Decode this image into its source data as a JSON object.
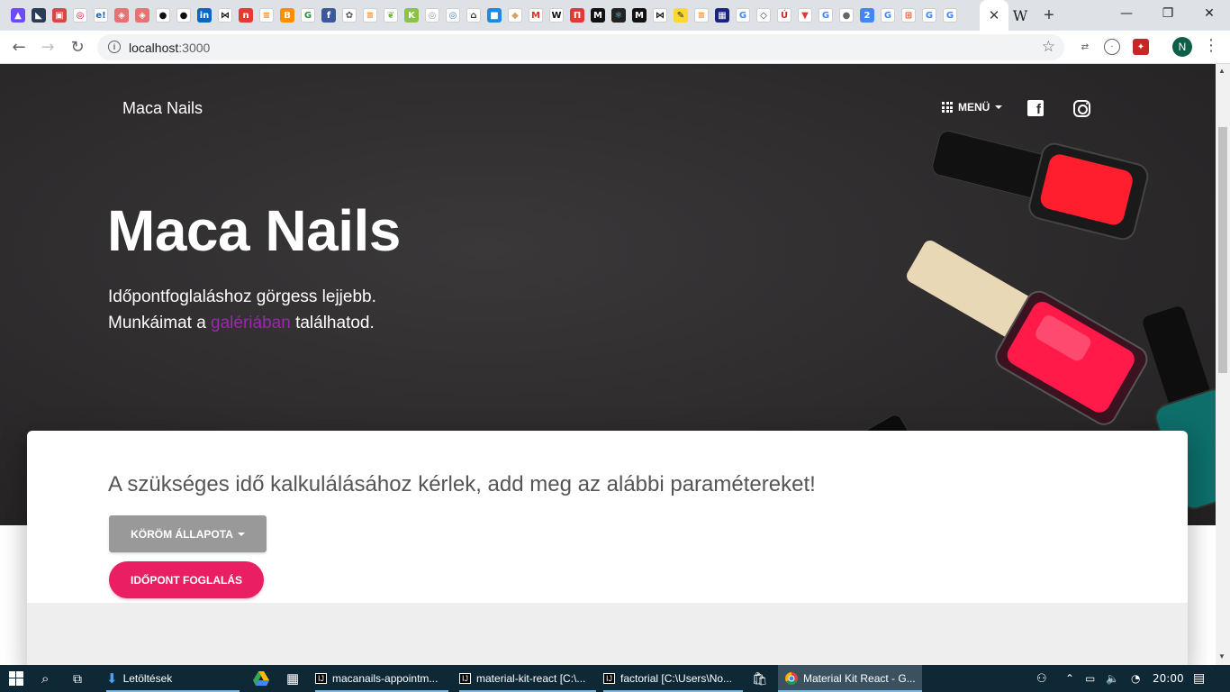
{
  "browser": {
    "tab_favicons": [
      {
        "name": "proton-icon",
        "glyph": "▲",
        "bg": "#6d4aff"
      },
      {
        "name": "zeplin-icon",
        "glyph": "◣",
        "bg": "#2b3a55"
      },
      {
        "name": "ext-red-icon",
        "glyph": "▣",
        "bg": "#d44"
      },
      {
        "name": "ring-icon",
        "glyph": "◎",
        "bg": "#fff",
        "fg": "#e03"
      },
      {
        "name": "eloquent-icon",
        "glyph": "e!",
        "bg": "#fff",
        "fg": "#1565c0"
      },
      {
        "name": "sketch-icon-1",
        "glyph": "◈",
        "bg": "#e57373"
      },
      {
        "name": "sketch-icon-2",
        "glyph": "◈",
        "bg": "#e57373"
      },
      {
        "name": "github-icon-1",
        "glyph": "●",
        "bg": "#fff",
        "fg": "#111"
      },
      {
        "name": "github-icon-2",
        "glyph": "●",
        "bg": "#fff",
        "fg": "#111"
      },
      {
        "name": "linkedin-icon",
        "glyph": "in",
        "bg": "#0a66c2"
      },
      {
        "name": "bowtie-icon",
        "glyph": "⋈",
        "bg": "#fff",
        "fg": "#111"
      },
      {
        "name": "n-icon",
        "glyph": "n",
        "bg": "#e53935"
      },
      {
        "name": "stackoverflow-icon-1",
        "glyph": "≡",
        "bg": "#fff",
        "fg": "#f48024"
      },
      {
        "name": "blogger-icon",
        "glyph": "B",
        "bg": "#ff8f00"
      },
      {
        "name": "geeks-icon",
        "glyph": "G",
        "bg": "#fff",
        "fg": "#2f8d46"
      },
      {
        "name": "facebook-icon",
        "glyph": "f",
        "bg": "#3b5998"
      },
      {
        "name": "meetup-icon",
        "glyph": "✿",
        "bg": "#fff",
        "fg": "#555"
      },
      {
        "name": "stackoverflow-icon-2",
        "glyph": "≡",
        "bg": "#fff",
        "fg": "#f48024"
      },
      {
        "name": "spring-icon",
        "glyph": "❦",
        "bg": "#fff",
        "fg": "#6db33f"
      },
      {
        "name": "kotlin-icon",
        "glyph": "K",
        "bg": "#8bc34a"
      },
      {
        "name": "circle-icon-1",
        "glyph": "◎",
        "bg": "#fff",
        "fg": "#999"
      },
      {
        "name": "circle-icon-2",
        "glyph": "◎",
        "bg": "#fff",
        "fg": "#3f7fbf"
      },
      {
        "name": "hat-icon",
        "glyph": "⌂",
        "bg": "#fff",
        "fg": "#333"
      },
      {
        "name": "box-icon",
        "glyph": "■",
        "bg": "#1e88e5"
      },
      {
        "name": "package-icon",
        "glyph": "◆",
        "bg": "#fff",
        "fg": "#d9a066"
      },
      {
        "name": "gmail-icon",
        "glyph": "M",
        "bg": "#fff",
        "fg": "#d93025"
      },
      {
        "name": "wikipedia-icon-1",
        "glyph": "W",
        "bg": "#fff",
        "fg": "#111"
      },
      {
        "name": "n-icon-2",
        "glyph": "П",
        "bg": "#e53935"
      },
      {
        "name": "medium-icon-1",
        "glyph": "M",
        "bg": "#111"
      },
      {
        "name": "react-icon",
        "glyph": "⚛",
        "bg": "#222",
        "fg": "#61dafb"
      },
      {
        "name": "medium-icon-2",
        "glyph": "M",
        "bg": "#111"
      },
      {
        "name": "bowtie-icon-2",
        "glyph": "⋈",
        "bg": "#fff",
        "fg": "#111"
      },
      {
        "name": "pencil-icon",
        "glyph": "✎",
        "bg": "#fdd835",
        "fg": "#222"
      },
      {
        "name": "stackoverflow-icon-3",
        "glyph": "≡",
        "bg": "#fff",
        "fg": "#f48024"
      },
      {
        "name": "chess-icon",
        "glyph": "▦",
        "bg": "#1a237e"
      },
      {
        "name": "google-icon-1",
        "glyph": "G",
        "bg": "#fff",
        "fg": "#4285f4"
      },
      {
        "name": "diamond-icon",
        "glyph": "◇",
        "bg": "#fff",
        "fg": "#333"
      },
      {
        "name": "u-accent-icon",
        "glyph": "Ú",
        "bg": "#fff",
        "fg": "#c62828"
      },
      {
        "name": "vivaldi-icon",
        "glyph": "▼",
        "bg": "#fff",
        "fg": "#e53935"
      },
      {
        "name": "google-icon-2",
        "glyph": "G",
        "bg": "#fff",
        "fg": "#4285f4"
      },
      {
        "name": "globe-icon",
        "glyph": "●",
        "bg": "#fff",
        "fg": "#666"
      },
      {
        "name": "calendar-icon",
        "glyph": "2",
        "bg": "#4285f4"
      },
      {
        "name": "google-icon-3",
        "glyph": "G",
        "bg": "#fff",
        "fg": "#4285f4"
      },
      {
        "name": "microsoft-icon",
        "glyph": "⊞",
        "bg": "#fff",
        "fg": "#f25022"
      },
      {
        "name": "google-icon-4",
        "glyph": "G",
        "bg": "#fff",
        "fg": "#4285f4"
      },
      {
        "name": "google-icon-5",
        "glyph": "G",
        "bg": "#fff",
        "fg": "#4285f4"
      }
    ],
    "active_tab_close": "✕",
    "extra_tab_glyph": "W",
    "new_tab": "+",
    "window_controls": {
      "minimize": "—",
      "maximize": "❐",
      "close": "✕"
    },
    "nav": {
      "back": "←",
      "forward": "→",
      "reload": "↻"
    },
    "url_host": "localhost",
    "url_port": ":3000",
    "star": "☆",
    "profile_initial": "N",
    "menu_dots": "⋮"
  },
  "page": {
    "brand": "Maca Nails",
    "menu_label": "MENÜ",
    "hero_title": "Maca Nails",
    "hero_line1": "Időpontfoglaláshoz görgess lejjebb.",
    "hero_line2_before": "Munkáimat a ",
    "hero_link": "galériában",
    "hero_line2_after": " találhatod.",
    "card_title": "A szükséges idő kalkulálásához kérlek, add meg az alábbi paramétereket!",
    "state_button": "KÖRÖM ÁLLAPOTA",
    "book_button": "IDŐPONT FOGLALÁS",
    "colors": {
      "primary_pink": "#e91e63",
      "link_purple": "#9c27b0",
      "hero_bg": "#2b292a"
    }
  },
  "taskbar": {
    "downloads": "Letöltések",
    "apps": [
      {
        "label": "macanails-appointm..."
      },
      {
        "label": "material-kit-react [C:\\..."
      },
      {
        "label": "factorial [C:\\Users\\No..."
      },
      {
        "label": "Material Kit React - G..."
      }
    ],
    "clock": "20:00"
  }
}
